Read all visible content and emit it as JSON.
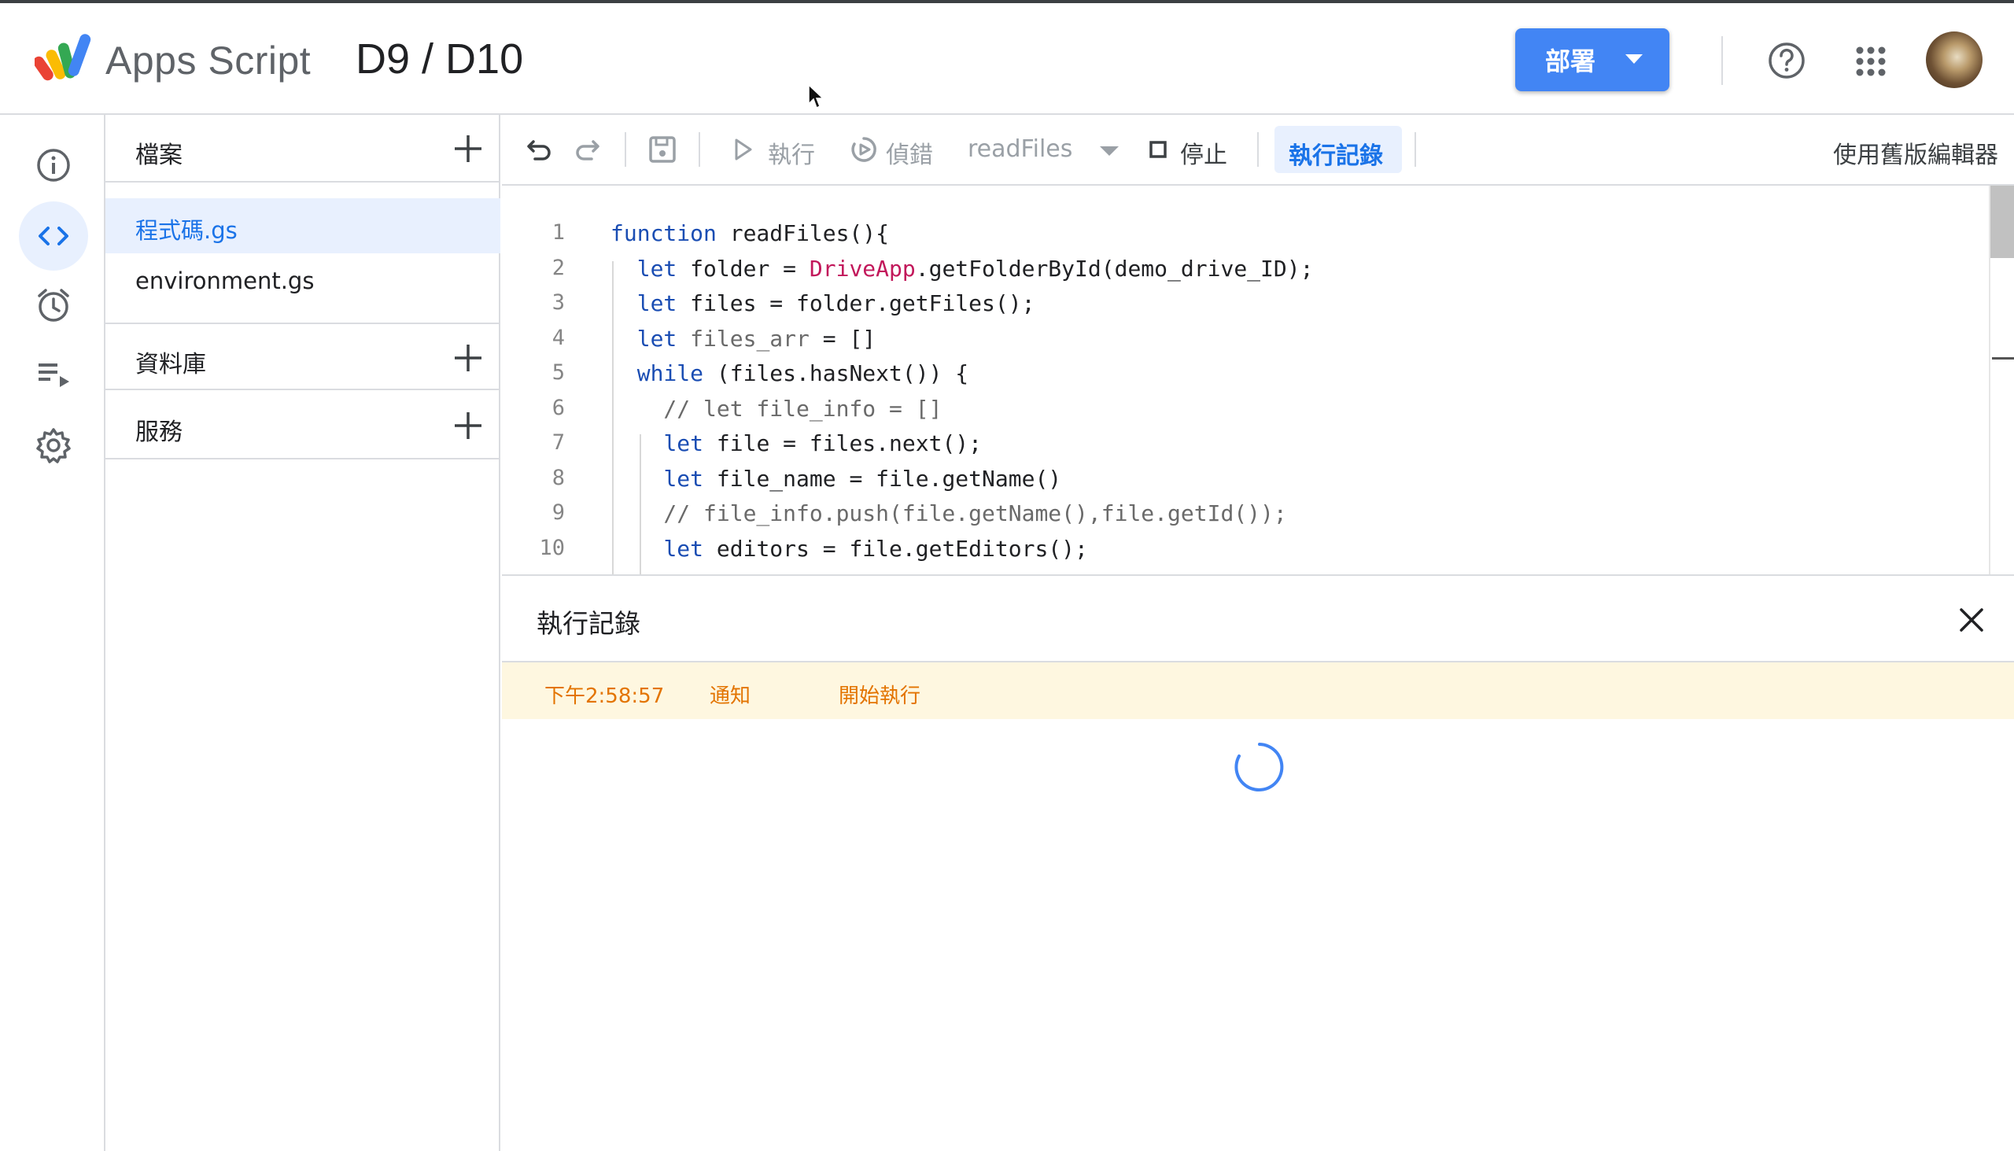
{
  "header": {
    "app_name": "Apps Script",
    "project_title": "D9 / D10",
    "deploy_label": "部署",
    "help_icon": "help-circle-icon",
    "apps_icon": "google-apps-grid-icon"
  },
  "rail": {
    "items": [
      {
        "name": "overview",
        "icon": "info-icon",
        "active": false
      },
      {
        "name": "editor",
        "icon": "code-icon",
        "active": true
      },
      {
        "name": "triggers",
        "icon": "alarm-clock-icon",
        "active": false
      },
      {
        "name": "executions",
        "icon": "playlist-play-icon",
        "active": false
      },
      {
        "name": "settings",
        "icon": "gear-icon",
        "active": false
      }
    ]
  },
  "files_panel": {
    "files_title": "檔案",
    "files": [
      {
        "name": "程式碼.gs",
        "selected": true
      },
      {
        "name": "environment.gs",
        "selected": false
      }
    ],
    "libraries_title": "資料庫",
    "services_title": "服務"
  },
  "toolbar": {
    "run_label": "執行",
    "debug_label": "偵錯",
    "function_name": "readFiles",
    "stop_label": "停止",
    "log_label": "執行記錄",
    "legacy_editor_label": "使用舊版編輯器"
  },
  "editor": {
    "line_numbers": [
      "1",
      "2",
      "3",
      "4",
      "5",
      "6",
      "7",
      "8",
      "9",
      "10"
    ],
    "lines": [
      [
        {
          "t": "function",
          "c": "kw"
        },
        {
          "t": " readFiles(){",
          "c": ""
        }
      ],
      [
        {
          "t": "  ",
          "c": ""
        },
        {
          "t": "let",
          "c": "kw"
        },
        {
          "t": " folder = ",
          "c": ""
        },
        {
          "t": "DriveApp",
          "c": "cls"
        },
        {
          "t": ".getFolderById(demo_drive_ID);",
          "c": ""
        }
      ],
      [
        {
          "t": "  ",
          "c": ""
        },
        {
          "t": "let",
          "c": "kw"
        },
        {
          "t": " files = folder.getFiles();",
          "c": ""
        }
      ],
      [
        {
          "t": "  ",
          "c": ""
        },
        {
          "t": "let",
          "c": "kw"
        },
        {
          "t": " files_arr",
          "c": "cmt"
        },
        {
          "t": " = []",
          "c": ""
        }
      ],
      [
        {
          "t": "  ",
          "c": ""
        },
        {
          "t": "while",
          "c": "kw"
        },
        {
          "t": " (files.hasNext()) {",
          "c": ""
        }
      ],
      [
        {
          "t": "    // let file_info = []",
          "c": "cmt"
        }
      ],
      [
        {
          "t": "    ",
          "c": ""
        },
        {
          "t": "let",
          "c": "kw"
        },
        {
          "t": " file = files.next();",
          "c": ""
        }
      ],
      [
        {
          "t": "    ",
          "c": ""
        },
        {
          "t": "let",
          "c": "kw"
        },
        {
          "t": " file_name = file.getName()",
          "c": ""
        }
      ],
      [
        {
          "t": "    // file_info.push(file.getName(),file.getId());",
          "c": "cmt"
        }
      ],
      [
        {
          "t": "    ",
          "c": ""
        },
        {
          "t": "let",
          "c": "kw"
        },
        {
          "t": " editors = file.getEditors();",
          "c": ""
        }
      ]
    ]
  },
  "execution_log": {
    "title": "執行記錄",
    "entries": [
      {
        "time": "下午2:58:57",
        "level": "通知",
        "message": "開始執行"
      }
    ]
  },
  "colors": {
    "accent_blue": "#4285f4",
    "selected_bg": "#e8f0fe",
    "log_row_bg": "#fef7e0",
    "log_text": "#e37400"
  }
}
